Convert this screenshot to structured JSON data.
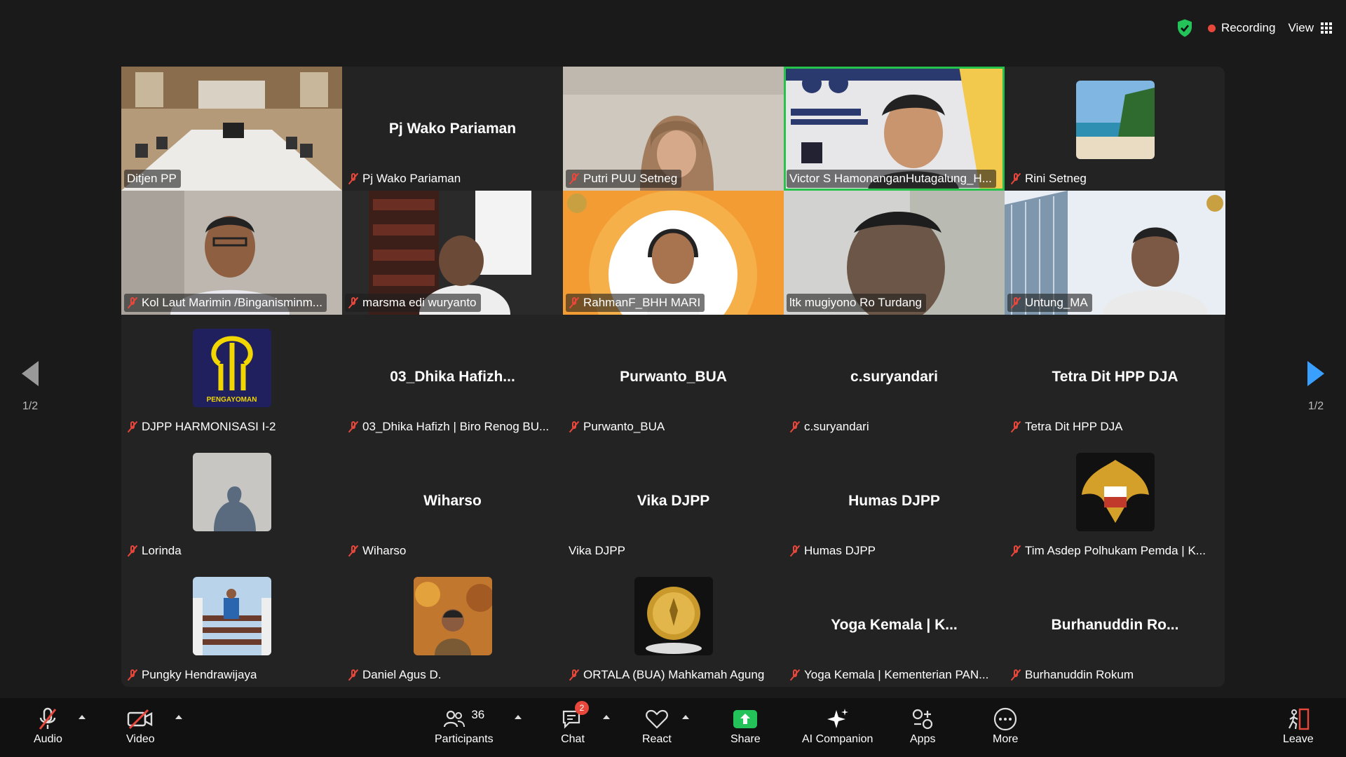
{
  "header": {
    "recording_label": "Recording",
    "view_label": "View"
  },
  "pagination": {
    "left_page": "1/2",
    "right_page": "1/2"
  },
  "tiles": [
    {
      "label": "Ditjen PP",
      "muted": false,
      "type": "video",
      "scene": "room"
    },
    {
      "label": "Pj Wako Pariaman",
      "muted": true,
      "type": "name",
      "display_name": "Pj Wako Pariaman"
    },
    {
      "label": "Putri PUU Setneg",
      "muted": true,
      "type": "video",
      "scene": "hijab"
    },
    {
      "label": "Victor S HamonanganHutagalung_H...",
      "muted": false,
      "type": "video",
      "scene": "banner",
      "active": true
    },
    {
      "label": "Rini Setneg",
      "muted": true,
      "type": "avatar",
      "scene": "beach"
    },
    {
      "label": "Kol Laut Marimin /Binganisminm...",
      "muted": true,
      "type": "video",
      "scene": "person"
    },
    {
      "label": "marsma edi wuryanto",
      "muted": true,
      "type": "video",
      "scene": "library"
    },
    {
      "label": "RahmanF_BHH MARI",
      "muted": true,
      "type": "video",
      "scene": "orange"
    },
    {
      "label": "ltk mugiyono Ro Turdang",
      "muted": false,
      "type": "video",
      "scene": "closeup"
    },
    {
      "label": "Untung_MA",
      "muted": true,
      "type": "video",
      "scene": "building"
    },
    {
      "label": "DJPP HARMONISASI I-2",
      "muted": true,
      "type": "avatar",
      "scene": "logo",
      "logo_text": "PENGAYOMAN"
    },
    {
      "label": "03_Dhika Hafizh | Biro Renog BU...",
      "muted": true,
      "type": "name",
      "display_name": "03_Dhika  Hafizh..."
    },
    {
      "label": "Purwanto_BUA",
      "muted": true,
      "type": "name",
      "display_name": "Purwanto_BUA"
    },
    {
      "label": "c.suryandari",
      "muted": true,
      "type": "name",
      "display_name": "c.suryandari"
    },
    {
      "label": "Tetra Dit HPP DJA",
      "muted": true,
      "type": "name",
      "display_name": "Tetra Dit HPP DJA"
    },
    {
      "label": "Lorinda",
      "muted": true,
      "type": "avatar",
      "scene": "shadow"
    },
    {
      "label": "Wiharso",
      "muted": true,
      "type": "name",
      "display_name": "Wiharso"
    },
    {
      "label": "Vika DJPP",
      "muted": false,
      "type": "name",
      "display_name": "Vika DJPP"
    },
    {
      "label": "Humas DJPP",
      "muted": true,
      "type": "name",
      "display_name": "Humas DJPP"
    },
    {
      "label": "Tim Asdep Polhukam Pemda | K...",
      "muted": true,
      "type": "avatar",
      "scene": "garuda"
    },
    {
      "label": "Pungky Hendrawijaya",
      "muted": true,
      "type": "avatar",
      "scene": "stairs"
    },
    {
      "label": "Daniel Agus D.",
      "muted": true,
      "type": "avatar",
      "scene": "autumn"
    },
    {
      "label": "ORTALA (BUA) Mahkamah Agung",
      "muted": true,
      "type": "avatar",
      "scene": "emblem"
    },
    {
      "label": "Yoga Kemala | Kementerian PAN...",
      "muted": true,
      "type": "name",
      "display_name": "Yoga Kemala | K..."
    },
    {
      "label": "Burhanuddin Rokum",
      "muted": true,
      "type": "name",
      "display_name": "Burhanuddin  Ro..."
    }
  ],
  "toolbar": {
    "audio": "Audio",
    "video": "Video",
    "participants": "Participants",
    "participants_count": "36",
    "chat": "Chat",
    "chat_badge": "2",
    "react": "React",
    "share": "Share",
    "ai_companion": "AI Companion",
    "apps": "Apps",
    "more": "More",
    "leave": "Leave"
  },
  "colors": {
    "active_border": "#27c24c",
    "share_green": "#23c35a",
    "mute_red": "#e8473b",
    "nav_blue": "#3aa0ff"
  }
}
